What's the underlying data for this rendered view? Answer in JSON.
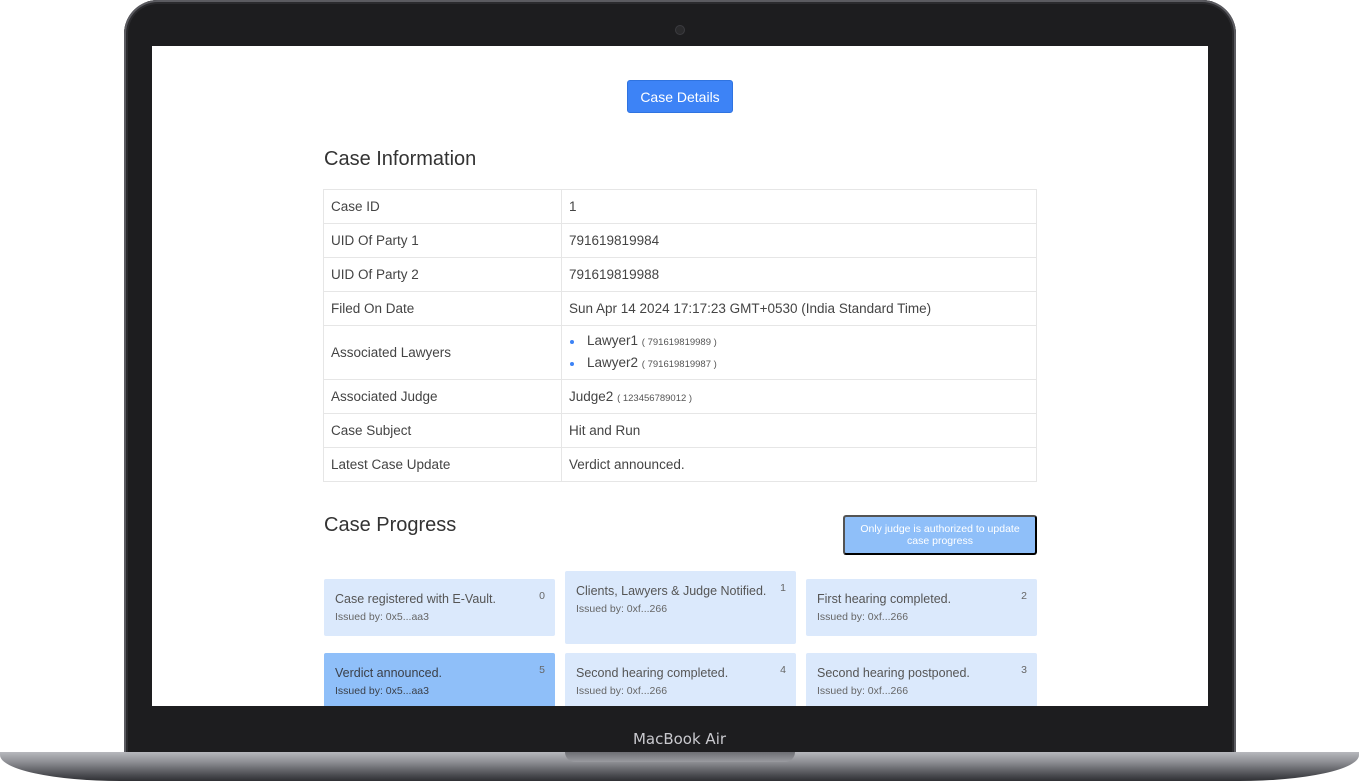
{
  "device": {
    "brand": "MacBook Air"
  },
  "header": {
    "case_details_button": "Case Details"
  },
  "case_information": {
    "title": "Case Information",
    "rows": [
      {
        "key": "Case ID",
        "value": "1"
      },
      {
        "key": "UID Of Party 1",
        "value": "791619819984"
      },
      {
        "key": "UID Of Party 2",
        "value": "791619819988"
      },
      {
        "key": "Filed On Date",
        "value": "Sun Apr 14 2024 17:17:23 GMT+0530 (India Standard Time)"
      },
      {
        "key": "Associated Lawyers",
        "lawyers": [
          {
            "name": "Lawyer1",
            "uid": "( 791619819989 )"
          },
          {
            "name": "Lawyer2",
            "uid": "( 791619819987 )"
          }
        ]
      },
      {
        "key": "Associated Judge",
        "judge": {
          "name": "Judge2",
          "uid": "( 123456789012 )"
        }
      },
      {
        "key": "Case Subject",
        "value": "Hit and Run"
      },
      {
        "key": "Latest Case Update",
        "value": "Verdict announced."
      }
    ]
  },
  "case_progress": {
    "title": "Case Progress",
    "auth_button": "Only judge is authorized to update case progress",
    "accent_active": "#8fbff9",
    "accent_card": "#dbe9fc",
    "steps": [
      {
        "num": "0",
        "title": "Case registered with E-Vault.",
        "issued": "Issued by: 0x5...aa3"
      },
      {
        "num": "1",
        "title": "Clients, Lawyers & Judge Notified.",
        "issued": "Issued by: 0xf...266"
      },
      {
        "num": "2",
        "title": "First hearing completed.",
        "issued": "Issued by: 0xf...266"
      },
      {
        "num": "3",
        "title": "Second hearing postponed.",
        "issued": "Issued by: 0xf...266"
      },
      {
        "num": "4",
        "title": "Second hearing completed.",
        "issued": "Issued by: 0xf...266"
      },
      {
        "num": "5",
        "title": "Verdict announced.",
        "issued": "Issued by: 0x5...aa3"
      }
    ]
  }
}
